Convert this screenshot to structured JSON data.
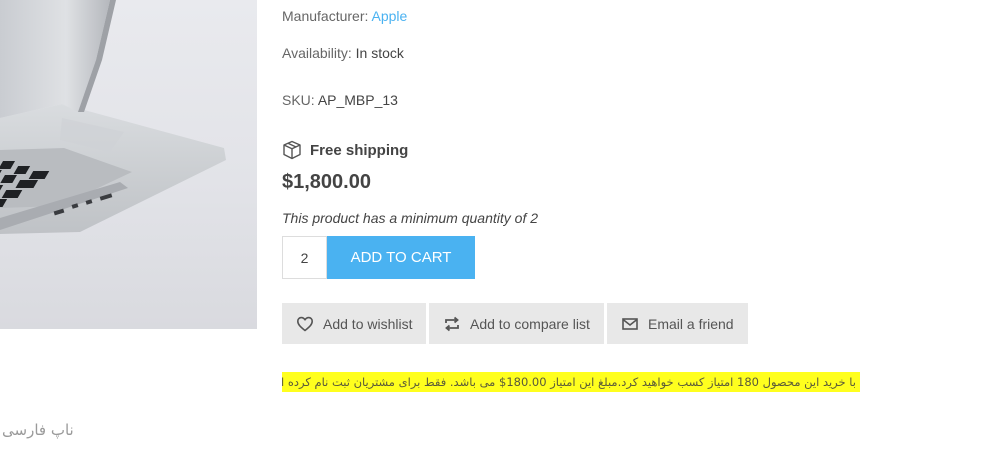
{
  "product": {
    "manufacturer_label": "Manufacturer:",
    "manufacturer_value": "Apple",
    "availability_label": "Availability:",
    "availability_value": "In stock",
    "sku_label": "SKU:",
    "sku_value": "AP_MBP_13",
    "shipping_text": "Free shipping",
    "price": "$1,800.00",
    "min_quantity_note": "This product has a minimum quantity of 2",
    "quantity_value": "2",
    "add_to_cart_label": "ADD TO CART"
  },
  "actions": {
    "wishlist_label": "Add to wishlist",
    "compare_label": "Add to compare list",
    "email_label": "Email a friend"
  },
  "reward_note": "با خرید این محصول 180 امتیاز کسب خواهید کرد.مبلغ این امتیاز 180.00$ می باشد. فقط برای مشتریان ثبت نام کرده است",
  "watermark_text": "ناپ فارسی",
  "icons": {
    "shipping": "package-box-icon",
    "wishlist": "heart-icon",
    "compare": "compare-arrows-icon",
    "email": "envelope-icon"
  },
  "colors": {
    "accent": "#4ab2f1",
    "button_bg": "#e8e8e8",
    "highlight": "#ffff1e"
  }
}
